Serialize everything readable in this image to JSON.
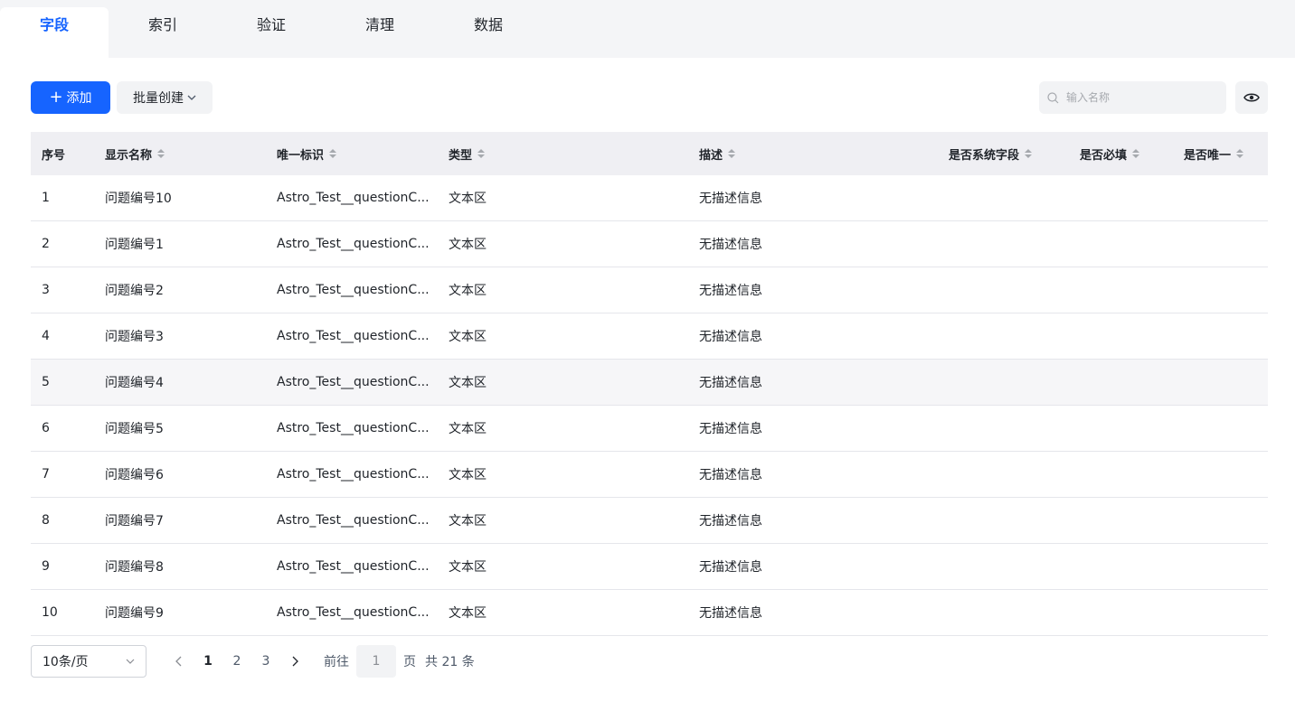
{
  "tabs": [
    {
      "label": "字段",
      "active": true
    },
    {
      "label": "索引",
      "active": false
    },
    {
      "label": "验证",
      "active": false
    },
    {
      "label": "清理",
      "active": false
    },
    {
      "label": "数据",
      "active": false
    }
  ],
  "toolbar": {
    "add_label": "添加",
    "batch_label": "批量创建",
    "search_placeholder": "输入名称"
  },
  "table": {
    "columns": [
      "序号",
      "显示名称",
      "唯一标识",
      "类型",
      "描述",
      "是否系统字段",
      "是否必填",
      "是否唯一"
    ],
    "rows": [
      {
        "index": "1",
        "name": "问题编号10",
        "key": "Astro_Test__questionC...",
        "type": "文本区",
        "desc": "无描述信息"
      },
      {
        "index": "2",
        "name": "问题编号1",
        "key": "Astro_Test__questionC...",
        "type": "文本区",
        "desc": "无描述信息"
      },
      {
        "index": "3",
        "name": "问题编号2",
        "key": "Astro_Test__questionC...",
        "type": "文本区",
        "desc": "无描述信息"
      },
      {
        "index": "4",
        "name": "问题编号3",
        "key": "Astro_Test__questionC...",
        "type": "文本区",
        "desc": "无描述信息"
      },
      {
        "index": "5",
        "name": "问题编号4",
        "key": "Astro_Test__questionC...",
        "type": "文本区",
        "desc": "无描述信息"
      },
      {
        "index": "6",
        "name": "问题编号5",
        "key": "Astro_Test__questionC...",
        "type": "文本区",
        "desc": "无描述信息"
      },
      {
        "index": "7",
        "name": "问题编号6",
        "key": "Astro_Test__questionC...",
        "type": "文本区",
        "desc": "无描述信息"
      },
      {
        "index": "8",
        "name": "问题编号7",
        "key": "Astro_Test__questionC...",
        "type": "文本区",
        "desc": "无描述信息"
      },
      {
        "index": "9",
        "name": "问题编号8",
        "key": "Astro_Test__questionC...",
        "type": "文本区",
        "desc": "无描述信息"
      },
      {
        "index": "10",
        "name": "问题编号9",
        "key": "Astro_Test__questionC...",
        "type": "文本区",
        "desc": "无描述信息"
      }
    ]
  },
  "pagination": {
    "page_size": "10条/页",
    "pages": [
      "1",
      "2",
      "3"
    ],
    "current": "1",
    "goto_prefix": "前往",
    "goto_value": "1",
    "goto_suffix": "页",
    "total": "共 21 条"
  },
  "colors": {
    "primary": "#1664ff",
    "header_bg": "#efeff3",
    "tabbar_bg": "#f4f5f7"
  },
  "icons": {
    "add": "plus-icon",
    "batch": "chevron-down-icon",
    "search": "search-icon",
    "visibility": "eye-icon",
    "sort": "sort-icon",
    "prev": "chevron-left-icon",
    "next": "chevron-right-icon"
  }
}
